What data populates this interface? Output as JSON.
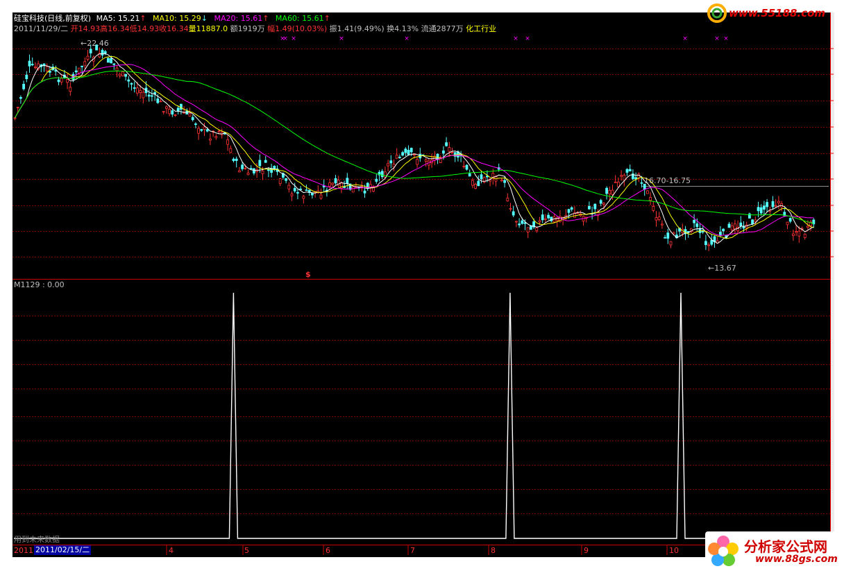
{
  "header": {
    "stock_title": "硅宝科技(日线,前复权)",
    "ma5_label": "MA5:",
    "ma5_value": "15.21",
    "ma5_arrow": "↑",
    "ma10_label": "MA10:",
    "ma10_value": "15.29",
    "ma10_arrow": "↓",
    "ma20_label": "MA20:",
    "ma20_value": "15.61",
    "ma20_arrow": "↑",
    "ma60_label": "MA60:",
    "ma60_value": "15.61",
    "ma60_arrow": "↑"
  },
  "quote": {
    "date": "2011/11/29/二",
    "open": "开14.93",
    "high": "高16.34",
    "low": "低14.93",
    "close": "收16.34",
    "volume": "量11887.0",
    "amount": "额1919万",
    "change": "幅1.49(10.03%)",
    "amplitude": "振1.41(9.49%)",
    "turnover": "换4.13%",
    "float": "流通2877万",
    "industry": "化工行业"
  },
  "annotations": {
    "high_label": "22.46",
    "low_label": "13.67",
    "range_label": "16.70-16.75",
    "signal_marker": "$"
  },
  "indicator": {
    "label": "M1129 : 0.00",
    "note": "用到未来数据",
    "spikes": [
      0.27,
      0.61,
      0.82
    ]
  },
  "timeline": {
    "year": "2011",
    "cursor_date": "2011/02/15/二",
    "month_labels": [
      "4",
      "5",
      "6",
      "7",
      "8",
      "9",
      "10"
    ]
  },
  "watermarks": {
    "top_url": "www.55188.com",
    "bottom_brand": "分析家公式网",
    "bottom_url": "www.88gs.com"
  },
  "colors": {
    "background": "#000000",
    "up": "#ff3232",
    "down": "#54ffff",
    "ma5": "#ffffff",
    "ma10": "#ffff00",
    "ma20": "#ff00ff",
    "ma60": "#00ff00",
    "grid": "#800000"
  }
}
